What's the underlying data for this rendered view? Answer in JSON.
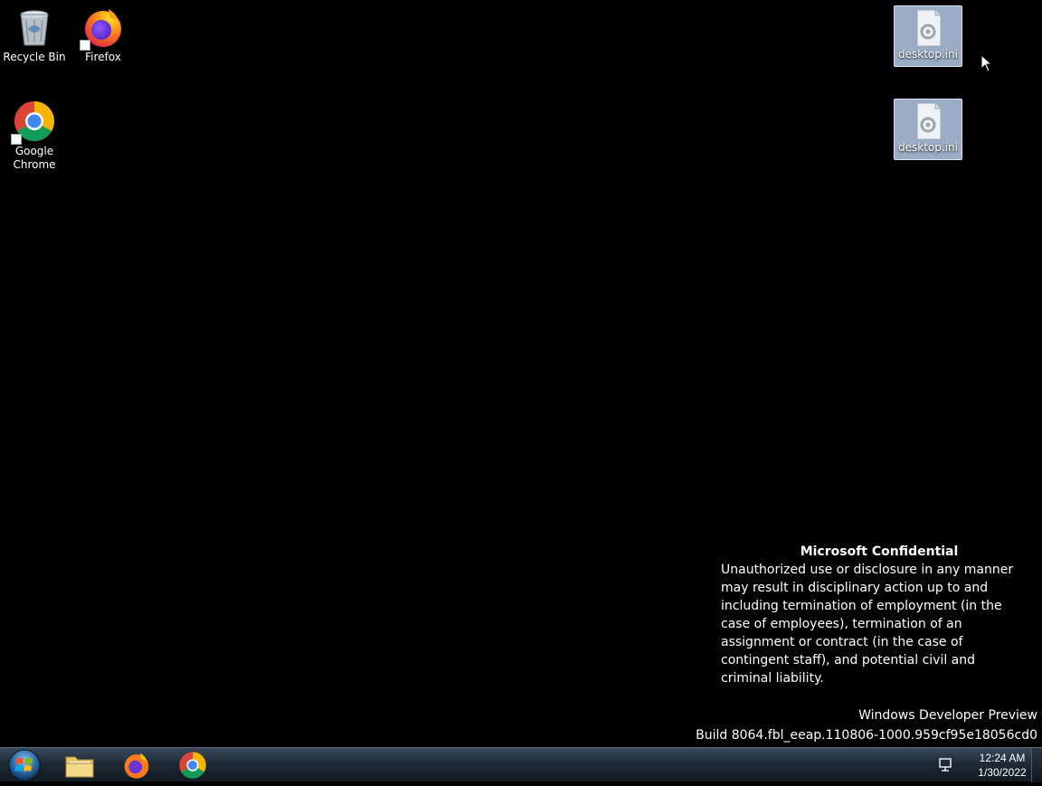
{
  "desktop": {
    "icons": [
      {
        "label": "Recycle Bin",
        "icon": "recycle-bin-icon"
      },
      {
        "label": "Firefox",
        "icon": "firefox-icon"
      },
      {
        "label": "Google Chrome",
        "icon": "chrome-icon"
      },
      {
        "label": "desktop.ini",
        "icon": "settings-file-icon"
      },
      {
        "label": "desktop.ini",
        "icon": "settings-file-icon"
      }
    ]
  },
  "watermark": {
    "title": "Microsoft Confidential",
    "body": "Unauthorized use or disclosure in any manner may result in disciplinary action up to and including termination of employment (in the case of employees), termination of an assignment or contract (in the case of contingent staff), and potential civil and criminal liability."
  },
  "build": {
    "edition": "Windows Developer Preview",
    "build_string": "Build 8064.fbl_eeap.110806-1000.959cf95e18056cd0"
  },
  "taskbar": {
    "start_icon": "windows-start-icon",
    "pinned": [
      {
        "name": "File Explorer",
        "icon": "folder-icon"
      },
      {
        "name": "Firefox",
        "icon": "firefox-icon"
      },
      {
        "name": "Google Chrome",
        "icon": "chrome-icon"
      }
    ],
    "tray": {
      "network_icon": "network-icon",
      "time": "12:24 AM",
      "date": "1/30/2022"
    }
  },
  "colors": {
    "background": "#000000",
    "selection": "#a8bcd6",
    "text": "#ffffff"
  }
}
